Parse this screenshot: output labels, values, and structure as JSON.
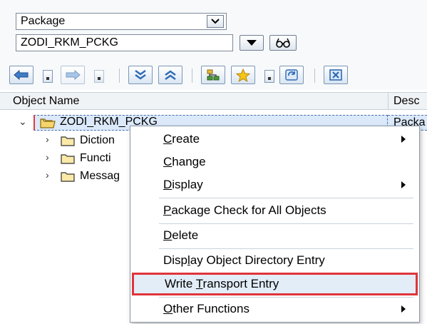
{
  "selector": {
    "object_type": "Package",
    "object_name": "ZODI_RKM_PCKG"
  },
  "icons": {
    "toolbar": [
      "back-arrow-icon",
      "forward-arrow-icon",
      "expand-all-icon",
      "collapse-all-icon",
      "hierarchy-icon",
      "favorites-star-icon",
      "refresh-icon",
      "close-window-icon"
    ],
    "input": [
      "dropdown-arrow-icon",
      "display-glasses-icon"
    ]
  },
  "colors": {
    "accent_blue": "#2e5f9e",
    "highlight_red": "#e0343a",
    "folder_yellow": "#f3d56b"
  },
  "tree": {
    "columns": [
      "Object Name",
      "Desc"
    ],
    "root": {
      "label": "ZODI_RKM_PCKG",
      "description": "Packa"
    },
    "children": [
      {
        "label": "Diction"
      },
      {
        "label": "Functi"
      },
      {
        "label": "Messag"
      }
    ]
  },
  "context_menu": {
    "items": [
      {
        "pre": "",
        "ul": "C",
        "post": "reate",
        "submenu": true
      },
      {
        "pre": "",
        "ul": "C",
        "post": "hange",
        "submenu": false
      },
      {
        "pre": "",
        "ul": "D",
        "post": "isplay",
        "submenu": true
      },
      {
        "pre": "",
        "ul": "P",
        "post": "ackage Check for All Objects",
        "submenu": false
      },
      {
        "pre": "",
        "ul": "D",
        "post": "elete",
        "submenu": false
      },
      {
        "pre": "Disp",
        "ul": "l",
        "post": "ay Object Directory Entry",
        "submenu": false
      },
      {
        "pre": "Write ",
        "ul": "T",
        "post": "ransport Entry",
        "submenu": false,
        "highlighted": true
      },
      {
        "pre": "",
        "ul": "O",
        "post": "ther Functions",
        "submenu": true
      }
    ]
  }
}
